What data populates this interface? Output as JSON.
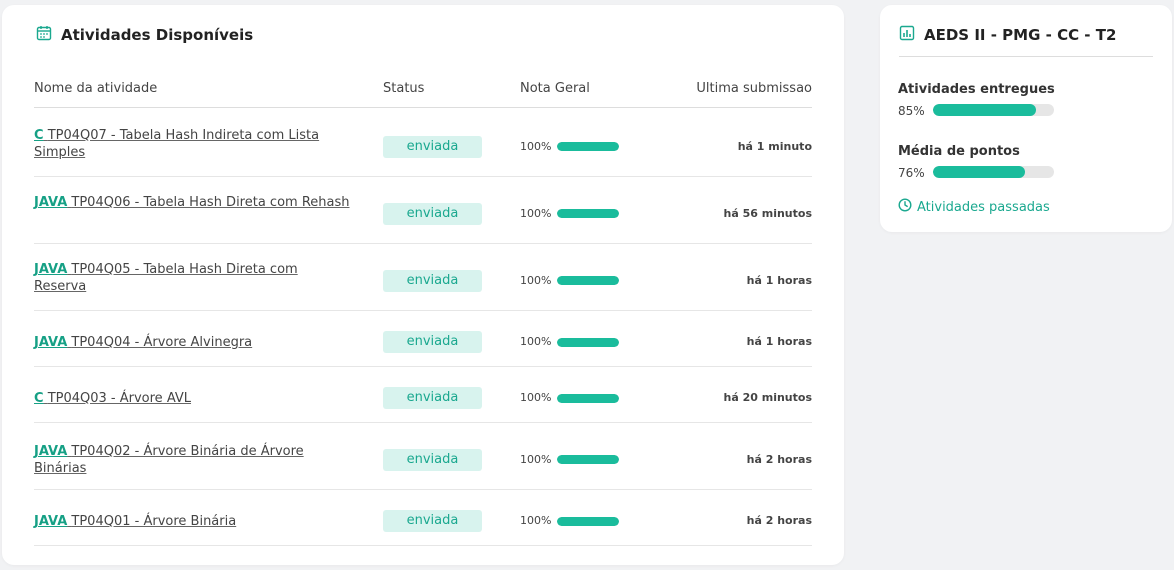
{
  "main": {
    "title": "Atividades Disponíveis",
    "columns": {
      "name": "Nome da atividade",
      "status": "Status",
      "nota": "Nota Geral",
      "ultima": "Ultima submissao"
    },
    "rows": [
      {
        "lang": "C",
        "name": "TP04Q07 - Tabela Hash Indireta com Lista Simples",
        "status": "enviada",
        "nota_label": "100%",
        "nota_value": 100,
        "time": "há 1 minuto"
      },
      {
        "lang": "JAVA",
        "name": "TP04Q06 - Tabela Hash Direta com Rehash",
        "status": "enviada",
        "nota_label": "100%",
        "nota_value": 100,
        "time": "há 56 minutos"
      },
      {
        "lang": "JAVA",
        "name": "TP04Q05 - Tabela Hash Direta com Reserva",
        "status": "enviada",
        "nota_label": "100%",
        "nota_value": 100,
        "time": "há 1 horas"
      },
      {
        "lang": "JAVA",
        "name": "TP04Q04 - Árvore Alvinegra",
        "status": "enviada",
        "nota_label": "100%",
        "nota_value": 100,
        "time": "há 1 horas"
      },
      {
        "lang": "C",
        "name": "TP04Q03 - Árvore AVL",
        "status": "enviada",
        "nota_label": "100%",
        "nota_value": 100,
        "time": "há 20 minutos"
      },
      {
        "lang": "JAVA",
        "name": "TP04Q02 - Árvore Binária de Árvore Binárias",
        "status": "enviada",
        "nota_label": "100%",
        "nota_value": 100,
        "time": "há 2 horas"
      },
      {
        "lang": "JAVA",
        "name": "TP04Q01 - Árvore Binária",
        "status": "enviada",
        "nota_label": "100%",
        "nota_value": 100,
        "time": "há 2 horas"
      }
    ]
  },
  "side": {
    "title": "AEDS II - PMG - CC - T2",
    "stats": [
      {
        "label": "Atividades entregues",
        "pct_label": "85%",
        "value": 85
      },
      {
        "label": "Média de pontos",
        "pct_label": "76%",
        "value": 76
      }
    ],
    "past_link": "Atividades passadas"
  },
  "colors": {
    "accent": "#1abc9c",
    "accent_text": "#16a085",
    "badge_bg": "#d8f3ee",
    "page_bg": "#f1f2f4"
  },
  "icons": {
    "main_title": "calendar-icon",
    "side_title": "bar-chart-icon",
    "past_link": "clock-icon"
  }
}
